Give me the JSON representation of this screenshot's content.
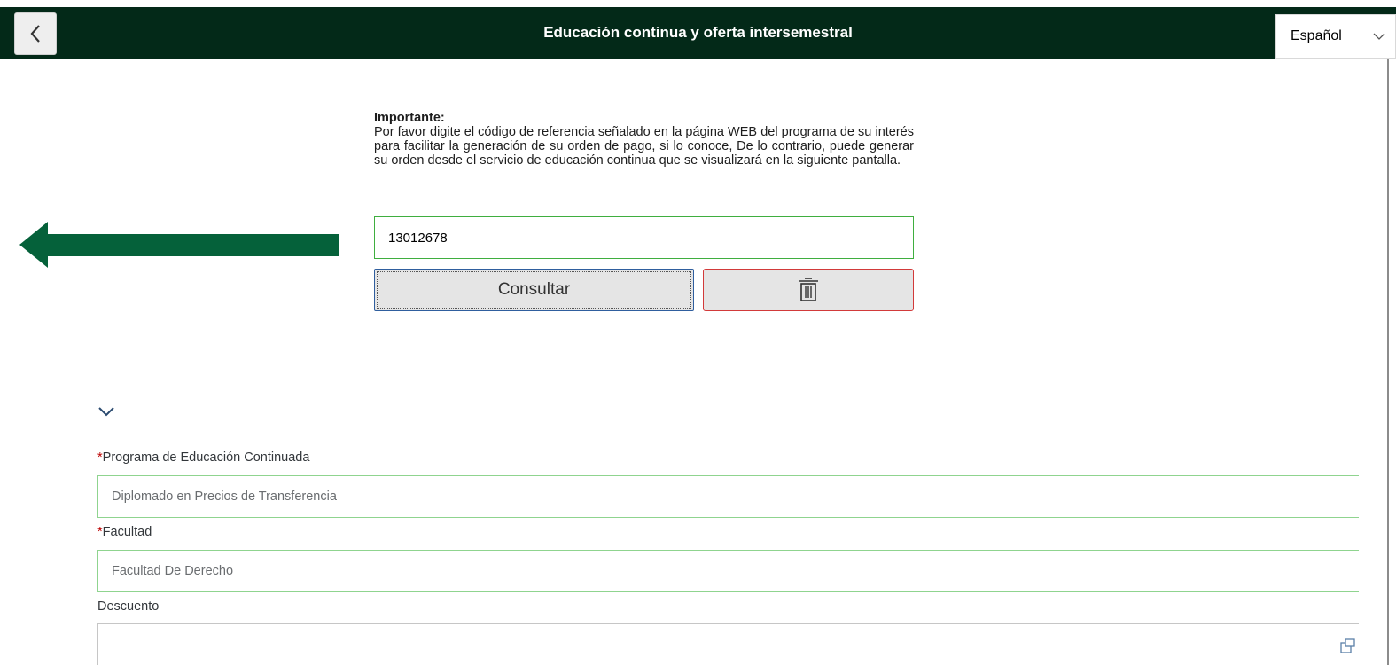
{
  "header": {
    "title": "Educación continua y oferta intersemestral",
    "back_icon": "chevron-left-icon",
    "language": {
      "selected": "Español",
      "icon": "chevron-down-icon"
    },
    "background": "#032918"
  },
  "notice": {
    "title": "Importante:",
    "body": "Por favor digite el código de referencia señalado en la página WEB del programa de su interés para facilitar la generación de su orden de pago, si lo conoce, De lo contrario, puede generar su orden desde el servicio de educación continua que se visualizará en la siguiente pantalla."
  },
  "search": {
    "value": "13012678",
    "consult_label": "Consultar",
    "delete_icon": "trash-icon"
  },
  "annotation": {
    "arrow_color": "#05613a",
    "icon": "arrow-left-icon"
  },
  "section": {
    "collapse_icon": "chevron-down-icon"
  },
  "form": {
    "programa": {
      "required_mark": "*",
      "label": "Programa de Educación Continuada",
      "value": "Diplomado en Precios de Transferencia"
    },
    "facultad": {
      "required_mark": "*",
      "label": "Facultad",
      "value": "Facultad De Derecho"
    },
    "descuento": {
      "label": "Descuento",
      "value": "",
      "icon": "value-help-icon"
    }
  }
}
